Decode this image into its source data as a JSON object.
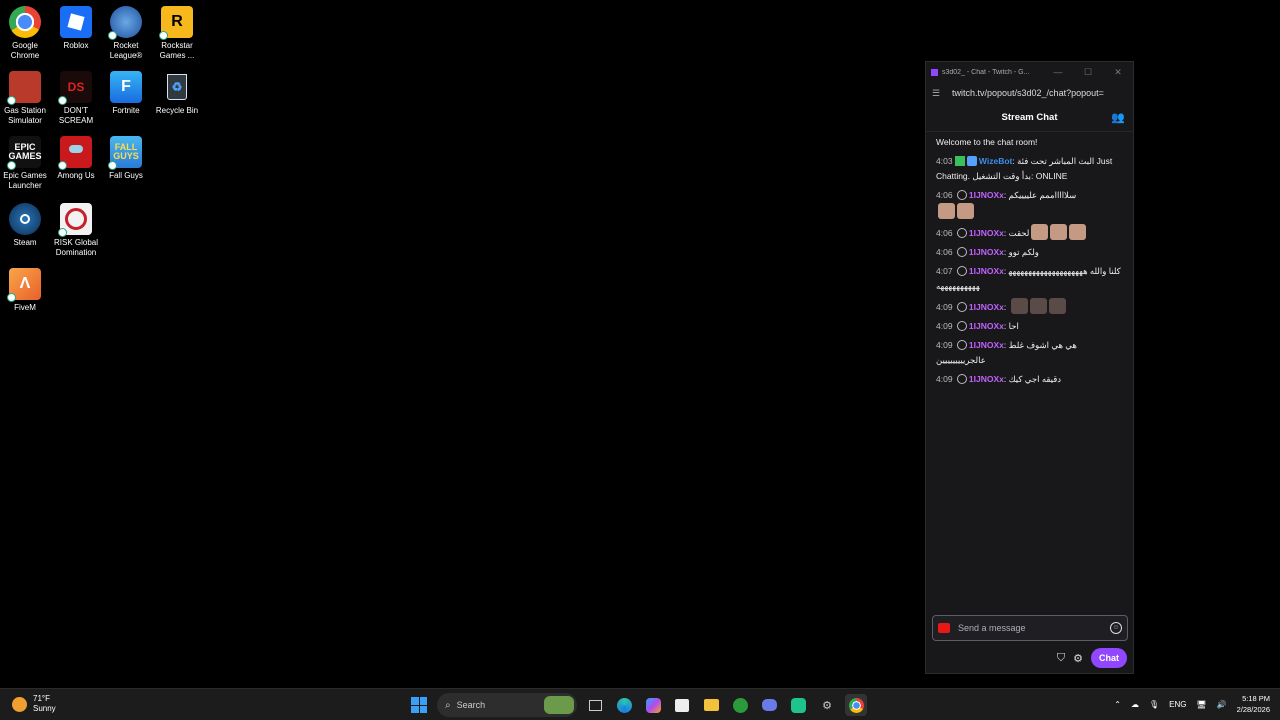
{
  "desktop_icons": [
    {
      "label": "Google Chrome",
      "icon": "chrome-icon"
    },
    {
      "label": "Roblox",
      "icon": "roblox-icon"
    },
    {
      "label": "Rocket League®",
      "icon": "rocket-league-icon"
    },
    {
      "label": "Rockstar Games ...",
      "icon": "rockstar-icon"
    },
    {
      "label": "Gas Station Simulator",
      "icon": "gas-station-icon"
    },
    {
      "label": "DON'T SCREAM",
      "icon": "dont-scream-icon"
    },
    {
      "label": "Fortnite",
      "icon": "fortnite-icon"
    },
    {
      "label": "Recycle Bin",
      "icon": "recycle-bin-icon"
    },
    {
      "label": "Epic Games Launcher",
      "icon": "epic-games-icon"
    },
    {
      "label": "Among Us",
      "icon": "among-us-icon"
    },
    {
      "label": "Fall Guys",
      "icon": "fall-guys-icon"
    },
    {
      "label": "Steam",
      "icon": "steam-icon"
    },
    {
      "label": "RISK Global Domination",
      "icon": "risk-icon"
    },
    {
      "label": "FiveM",
      "icon": "fivem-icon"
    }
  ],
  "chat_window": {
    "title": "s3d02_ - Chat - Twitch - G...",
    "url": "twitch.tv/popout/s3d02_/chat?popout=",
    "header": "Stream Chat",
    "welcome": "Welcome to the chat room!",
    "messages": [
      {
        "time": "4:03",
        "user": "WizeBot",
        "text": "البث المباشر تحت فئة Just Chatting. بدأ وقت التشغيل: ONLINE"
      },
      {
        "time": "4:06",
        "user": "1IJNOXx",
        "text": "سلاااااممم علييييكم"
      },
      {
        "time": "4:06",
        "user": "1IJNOXx",
        "text": "لحقت"
      },
      {
        "time": "4:06",
        "user": "1IJNOXx",
        "text": "ولكم توو"
      },
      {
        "time": "4:07",
        "user": "1IJNOXx",
        "text": "كلنا والله ههههههههههههههههههههههههههههههه"
      },
      {
        "time": "4:09",
        "user": "1IJNOXx",
        "text": ""
      },
      {
        "time": "4:09",
        "user": "1IJNOXx",
        "text": "احا"
      },
      {
        "time": "4:09",
        "user": "1IJNOXx",
        "text": "هي هي اشوف غلط عالجرييييييييين"
      },
      {
        "time": "4:09",
        "user": "1IJNOXx",
        "text": "دقيقه اجي كيك"
      }
    ],
    "input_placeholder": "Send a message",
    "chat_button": "Chat"
  },
  "taskbar": {
    "weather_temp": "71°F",
    "weather_desc": "Sunny",
    "search_label": "Search",
    "lang": "ENG",
    "time": "5:18 PM",
    "date": "2/28/2026"
  }
}
